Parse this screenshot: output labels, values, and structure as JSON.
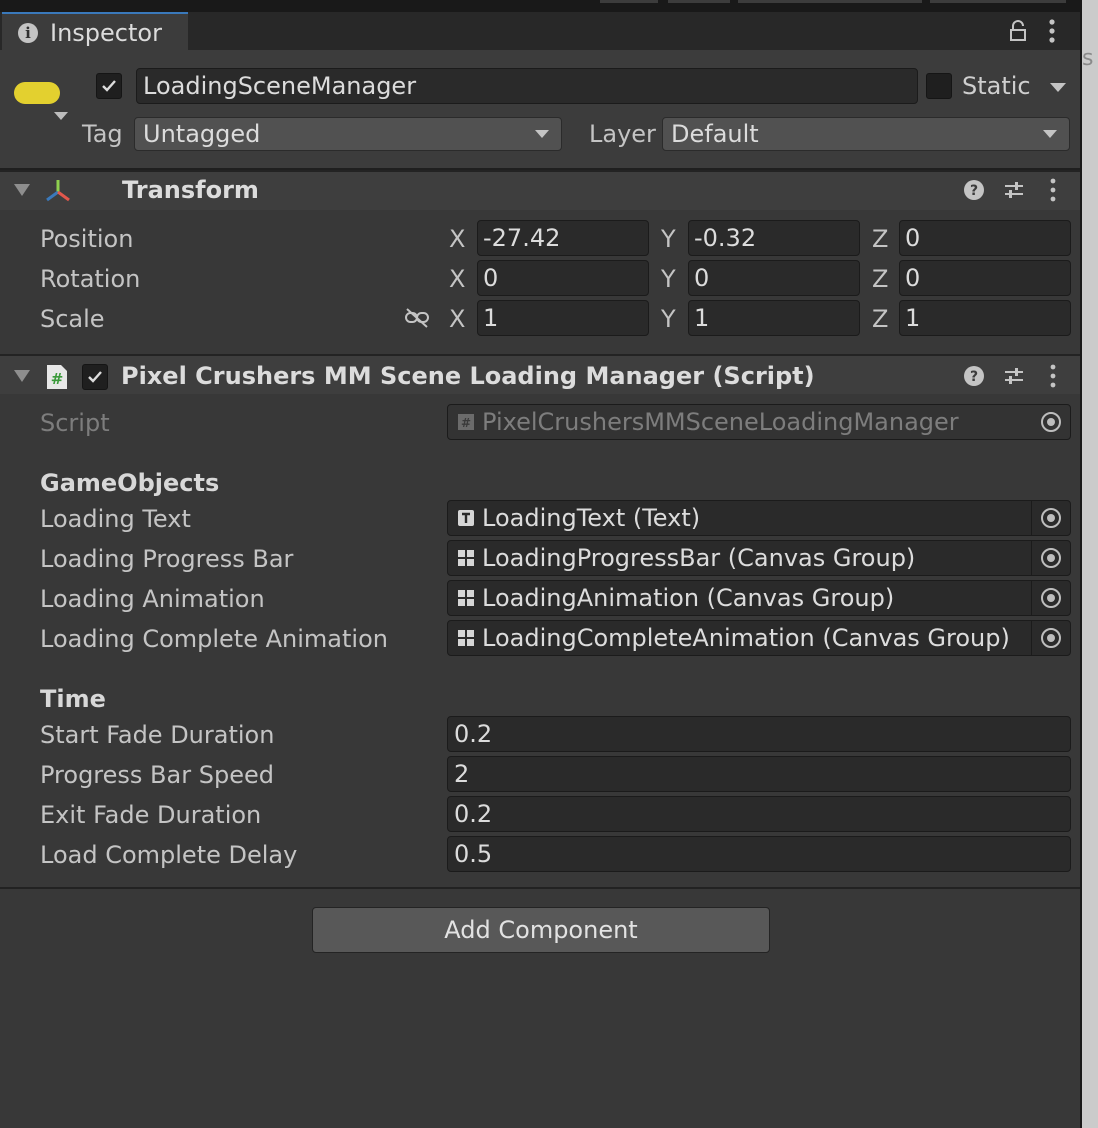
{
  "tab": {
    "title": "Inspector"
  },
  "gameobject": {
    "enabled": true,
    "name": "LoadingSceneManager",
    "static_label": "Static",
    "static_checked": false,
    "tag_label": "Tag",
    "tag_value": "Untagged",
    "layer_label": "Layer",
    "layer_value": "Default"
  },
  "transform": {
    "title": "Transform",
    "position": {
      "label": "Position",
      "x": "-27.42",
      "y": "-0.32",
      "z": "0"
    },
    "rotation": {
      "label": "Rotation",
      "x": "0",
      "y": "0",
      "z": "0"
    },
    "scale": {
      "label": "Scale",
      "x": "1",
      "y": "1",
      "z": "1"
    },
    "axis_x": "X",
    "axis_y": "Y",
    "axis_z": "Z"
  },
  "script_component": {
    "enabled": true,
    "title": "Pixel Crushers MM Scene Loading Manager (Script)",
    "script_label": "Script",
    "script_value": "PixelCrushersMMSceneLoadingManager",
    "gameobjects_header": "GameObjects",
    "fields": [
      {
        "label": "Loading Text",
        "value": "LoadingText (Text)",
        "icon": "text-component-icon"
      },
      {
        "label": "Loading Progress Bar",
        "value": "LoadingProgressBar (Canvas Group)",
        "icon": "canvas-group-icon"
      },
      {
        "label": "Loading Animation",
        "value": "LoadingAnimation (Canvas Group)",
        "icon": "canvas-group-icon"
      },
      {
        "label": "Loading Complete Animation",
        "value": "LoadingCompleteAnimation (Canvas Group)",
        "icon": "canvas-group-icon"
      }
    ],
    "time_header": "Time",
    "time_fields": [
      {
        "label": "Start Fade Duration",
        "value": "0.2"
      },
      {
        "label": "Progress Bar Speed",
        "value": "2"
      },
      {
        "label": "Exit Fade Duration",
        "value": "0.2"
      },
      {
        "label": "Load Complete Delay",
        "value": "0.5"
      }
    ]
  },
  "add_component_label": "Add Component",
  "colors": {
    "accent": "#3a79bb",
    "gameobject_icon": "#e3d02f",
    "background": "#383838"
  }
}
